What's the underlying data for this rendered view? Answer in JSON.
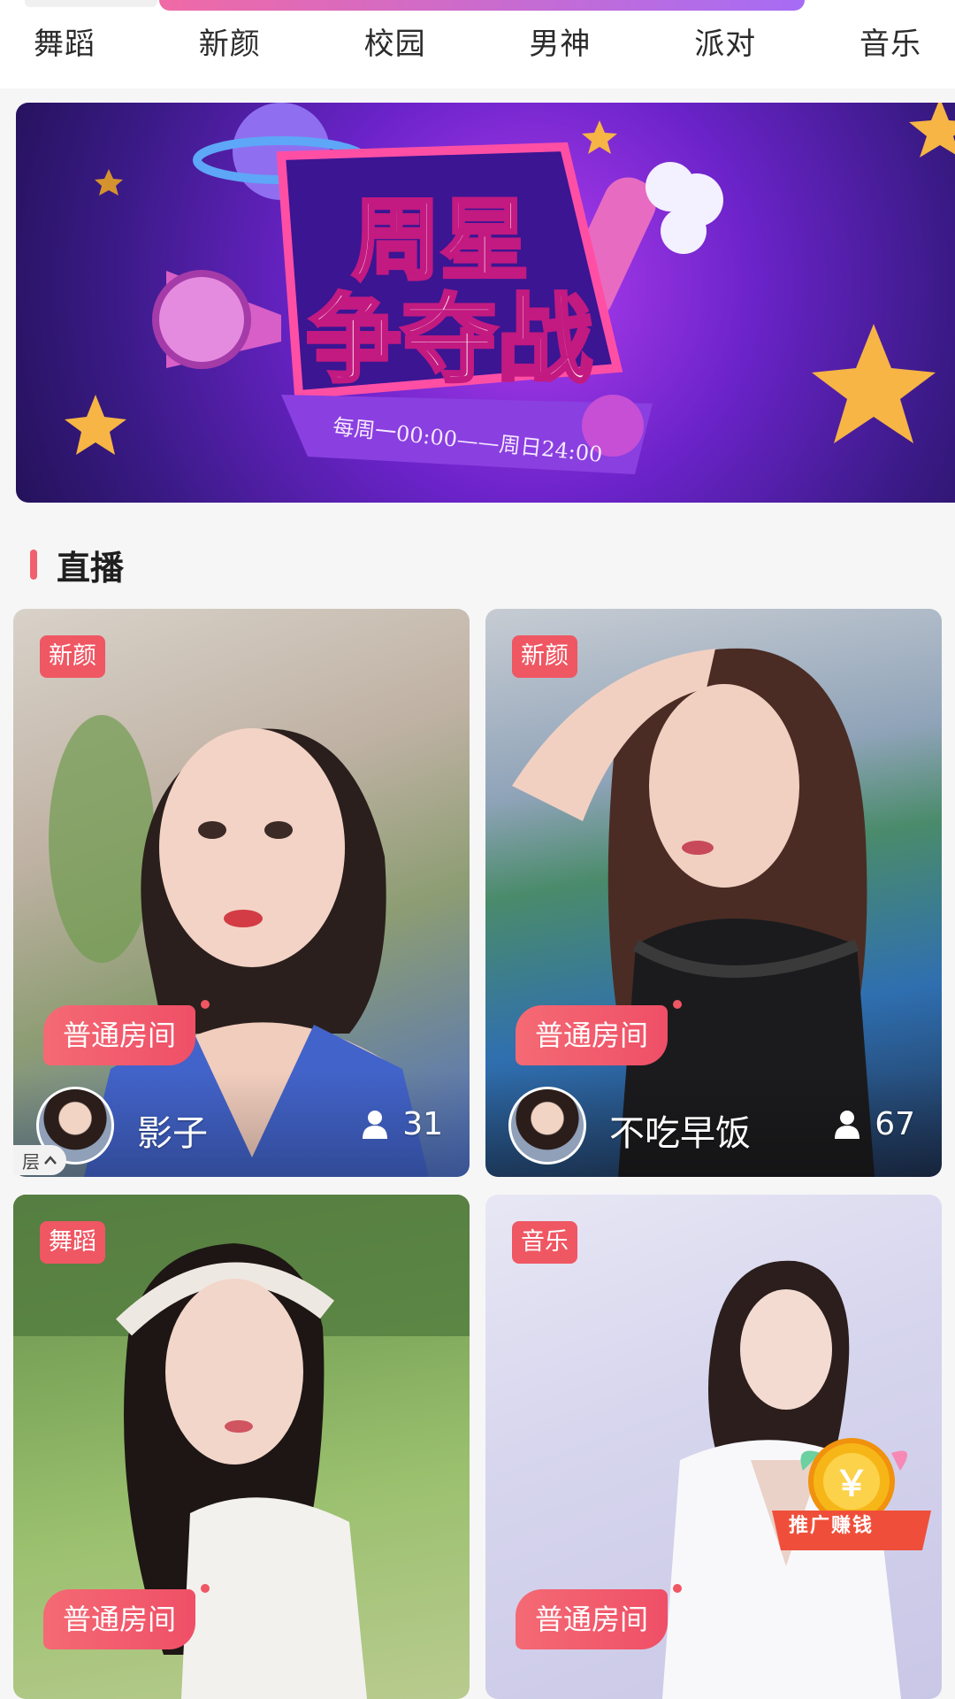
{
  "tabs": [
    "舞蹈",
    "新颜",
    "校园",
    "男神",
    "派对",
    "音乐"
  ],
  "banner": {
    "title_line1": "周星",
    "title_line2": "争夺战",
    "subtitle": "每周一00:00——周日24:00"
  },
  "section": {
    "title": "直播"
  },
  "cards": [
    {
      "category": "新颜",
      "room": "普通房间",
      "name": "影子",
      "viewers": "31"
    },
    {
      "category": "新颜",
      "room": "普通房间",
      "name": "不吃早饭",
      "viewers": "67"
    },
    {
      "category": "舞蹈",
      "room": "普通房间"
    },
    {
      "category": "音乐",
      "room": "普通房间"
    }
  ],
  "floating": {
    "label": "层",
    "icon": "chevron-up-icon"
  },
  "promo": {
    "label": "推广赚钱",
    "coin_symbol": "￥"
  },
  "colors": {
    "accent": "#ef5763",
    "tab_gradient_start": "#f06aa5",
    "tab_gradient_end": "#a66cf5"
  }
}
